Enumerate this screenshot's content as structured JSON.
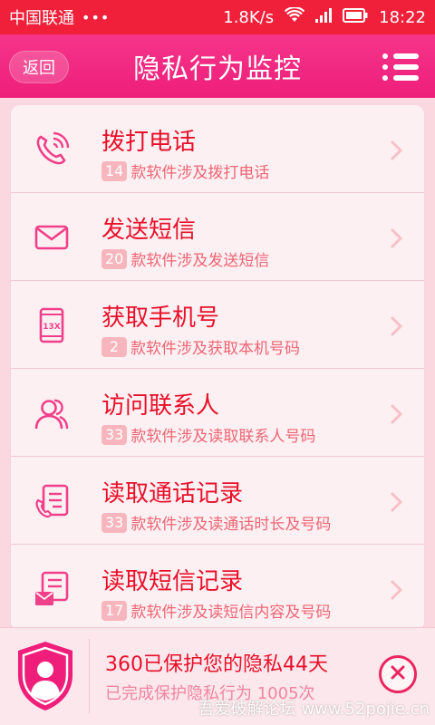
{
  "status_bar": {
    "carrier": "中国联通",
    "dots": "•••",
    "speed": "1.8K/s",
    "time": "18:22"
  },
  "header": {
    "back_label": "返回",
    "title": "隐私行为监控"
  },
  "items": [
    {
      "icon": "phone-call-icon",
      "name": "拨打电话",
      "count": "14",
      "desc": "款软件涉及拨打电话"
    },
    {
      "icon": "envelope-icon",
      "name": "发送短信",
      "count": "20",
      "desc": "款软件涉及发送短信"
    },
    {
      "icon": "mobile-number-icon",
      "icon_text": "13X",
      "name": "获取手机号",
      "count": "2",
      "desc": "款软件涉及获取本机号码"
    },
    {
      "icon": "contacts-icon",
      "name": "访问联系人",
      "count": "33",
      "desc": "款软件涉及读取联系人号码"
    },
    {
      "icon": "call-log-icon",
      "name": "读取通话记录",
      "count": "33",
      "desc": "款软件涉及读通话时长及号码"
    },
    {
      "icon": "sms-log-icon",
      "name": "读取短信记录",
      "count": "17",
      "desc": "款软件涉及读短信内容及号码"
    }
  ],
  "footer": {
    "line1": "360已保护您的隐私44天",
    "line2": "已完成保护隐私行为 1005次"
  },
  "watermark": "吾爱破解论坛 www.52pojie.cn",
  "colors": {
    "status_bar": "#f0203a",
    "header": "#ee1e7a",
    "primary_text": "#e8102a",
    "icon": "#f0408a"
  }
}
